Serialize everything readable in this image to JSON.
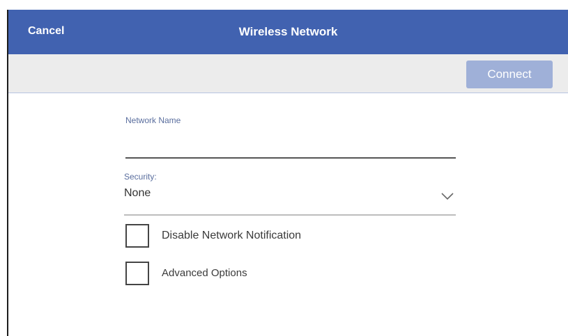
{
  "header": {
    "cancel_label": "Cancel",
    "title": "Wireless Network"
  },
  "toolbar": {
    "connect_label": "Connect"
  },
  "form": {
    "network_name": {
      "label": "Network Name",
      "value": ""
    },
    "security": {
      "label": "Security:",
      "value": "None"
    },
    "options": [
      {
        "label": "Disable Network Notification",
        "checked": false
      },
      {
        "label": "Advanced Options",
        "checked": false
      }
    ]
  },
  "icons": {
    "dropdown": "chevron-down-icon"
  },
  "colors": {
    "header_bg": "#4162b0",
    "toolbar_bg": "#ececec",
    "connect_disabled_bg": "#9fb0d8",
    "field_label": "#5a6e9e"
  }
}
